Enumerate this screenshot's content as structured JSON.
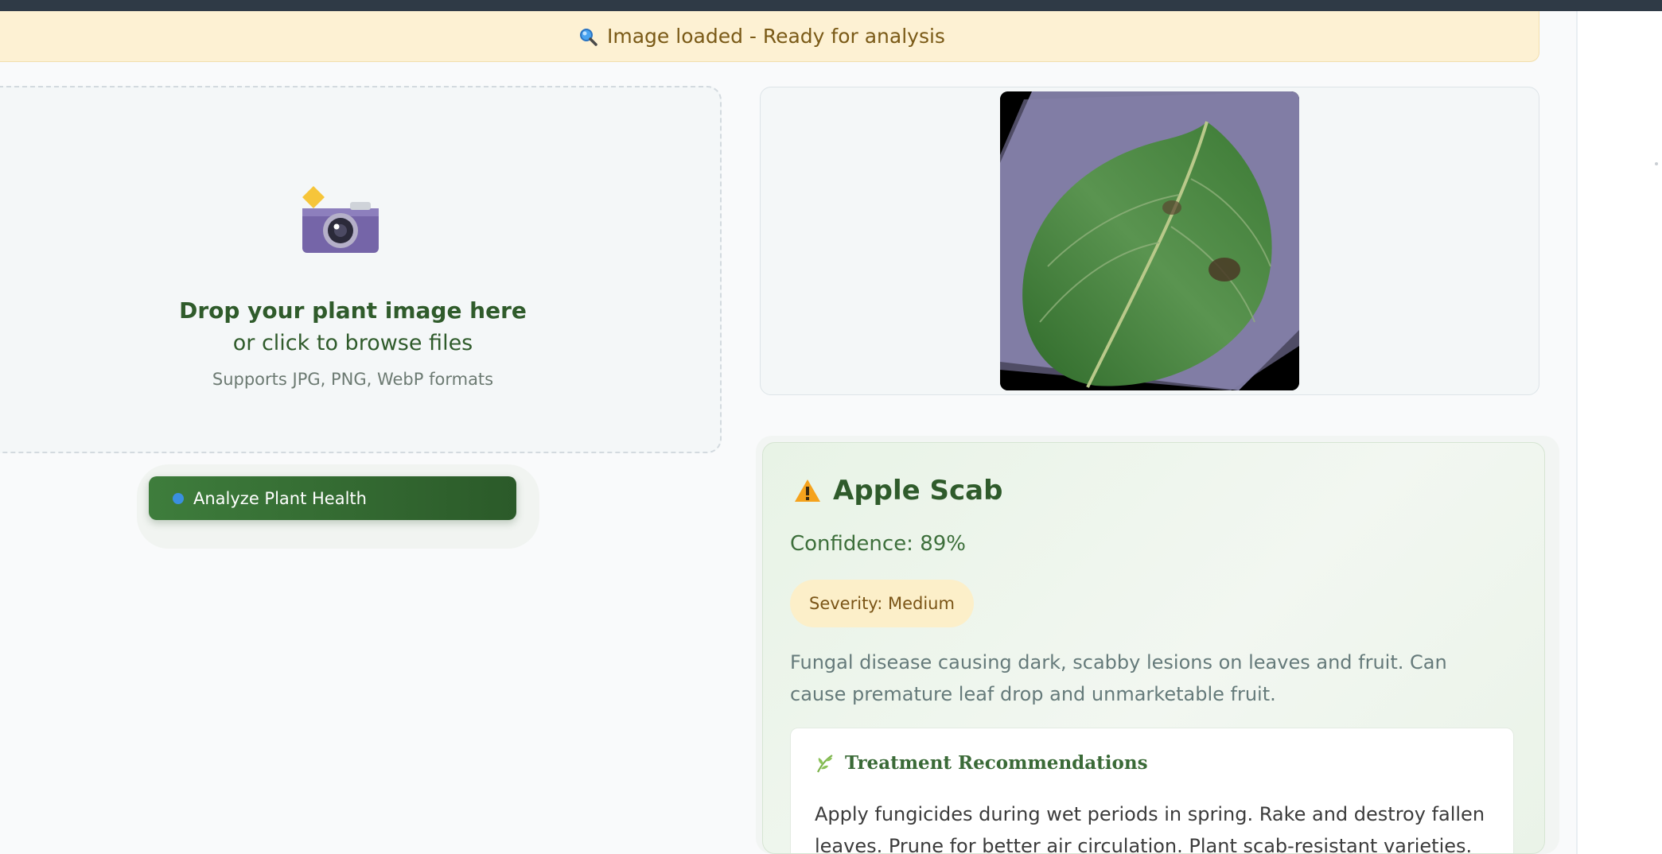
{
  "status_banner": {
    "icon": "magnifier-icon",
    "text": "Image loaded - Ready for analysis"
  },
  "upload": {
    "icon": "camera-icon",
    "title": "Drop your plant image here",
    "subtitle": "or click to browse files",
    "formats": "Supports JPG, PNG, WebP formats"
  },
  "analyze_button": {
    "icon": "magnifier-icon",
    "label": "Analyze Plant Health"
  },
  "preview": {
    "image": "uploaded-leaf-image"
  },
  "diagnosis": {
    "icon": "warning-icon",
    "title": "Apple Scab",
    "confidence": "Confidence: 89%",
    "severity": "Severity: Medium",
    "description": "Fungal disease causing dark, scabby lesions on leaves and fruit. Can cause premature leaf drop and unmarketable fruit.",
    "treatment": {
      "icon": "herb-icon",
      "title": "Treatment Recommendations",
      "text": "Apply fungicides during wet periods in spring. Rake and destroy fallen leaves. Prune for better air circulation. Plant scab-resistant varieties."
    }
  },
  "colors": {
    "primary_green": "#2f5b2b",
    "button_green": "#3e7d3c",
    "banner_bg": "#fdf1d3",
    "banner_text": "#7a5a17",
    "severity_bg": "#fcefc9",
    "top_bar": "#2f3a46"
  }
}
